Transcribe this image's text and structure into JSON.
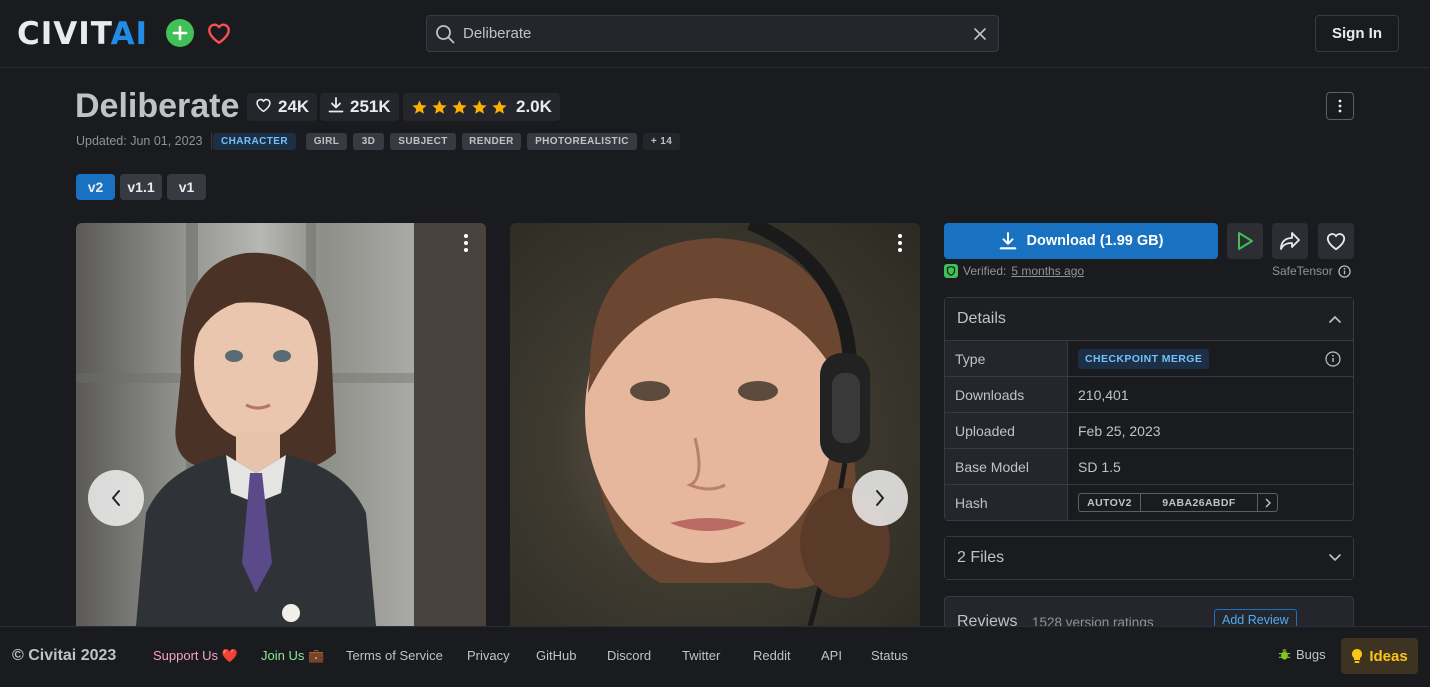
{
  "header": {
    "logo_prefix": "CIVIT",
    "logo_suffix": "AI",
    "search_value": "Deliberate",
    "sign_in": "Sign In"
  },
  "model": {
    "title": "Deliberate",
    "likes": "24K",
    "downloads": "251K",
    "rating": 5,
    "rating_count": "2.0K",
    "updated": "Updated: Jun 01, 2023",
    "tags": [
      "CHARACTER",
      "GIRL",
      "3D",
      "SUBJECT",
      "RENDER",
      "PHOTOREALISTIC",
      "+ 14"
    ],
    "versions": [
      "v2",
      "v1.1",
      "v1"
    ],
    "active_version": "v2"
  },
  "actions": {
    "download_label": "Download (1.99 GB)",
    "verified_label": "Verified:",
    "verified_time": "5 months ago",
    "format": "SafeTensor"
  },
  "details": {
    "heading": "Details",
    "rows": [
      {
        "key": "Type",
        "value": "CHECKPOINT MERGE"
      },
      {
        "key": "Downloads",
        "value": "210,401"
      },
      {
        "key": "Uploaded",
        "value": "Feb 25, 2023"
      },
      {
        "key": "Base Model",
        "value": "SD 1.5"
      },
      {
        "key": "Hash",
        "value": "9ABA26ABDF",
        "hash_type": "AUTOV2"
      }
    ]
  },
  "files": {
    "label": "2 Files"
  },
  "reviews": {
    "label": "Reviews",
    "count_text": "1528 version ratings",
    "add_review": "Add Review"
  },
  "footer": {
    "copyright": "© Civitai 2023",
    "support": "Support Us ❤️",
    "join": "Join Us 💼",
    "links": [
      "Terms of Service",
      "Privacy",
      "GitHub",
      "Discord",
      "Twitter",
      "Reddit",
      "API",
      "Status"
    ],
    "bugs": "Bugs",
    "ideas": "Ideas"
  },
  "colors": {
    "accent": "#228be6",
    "primary_button": "#1971c2",
    "star": "#fab005",
    "verified": "#40c057",
    "ideas": "#fcc419"
  }
}
